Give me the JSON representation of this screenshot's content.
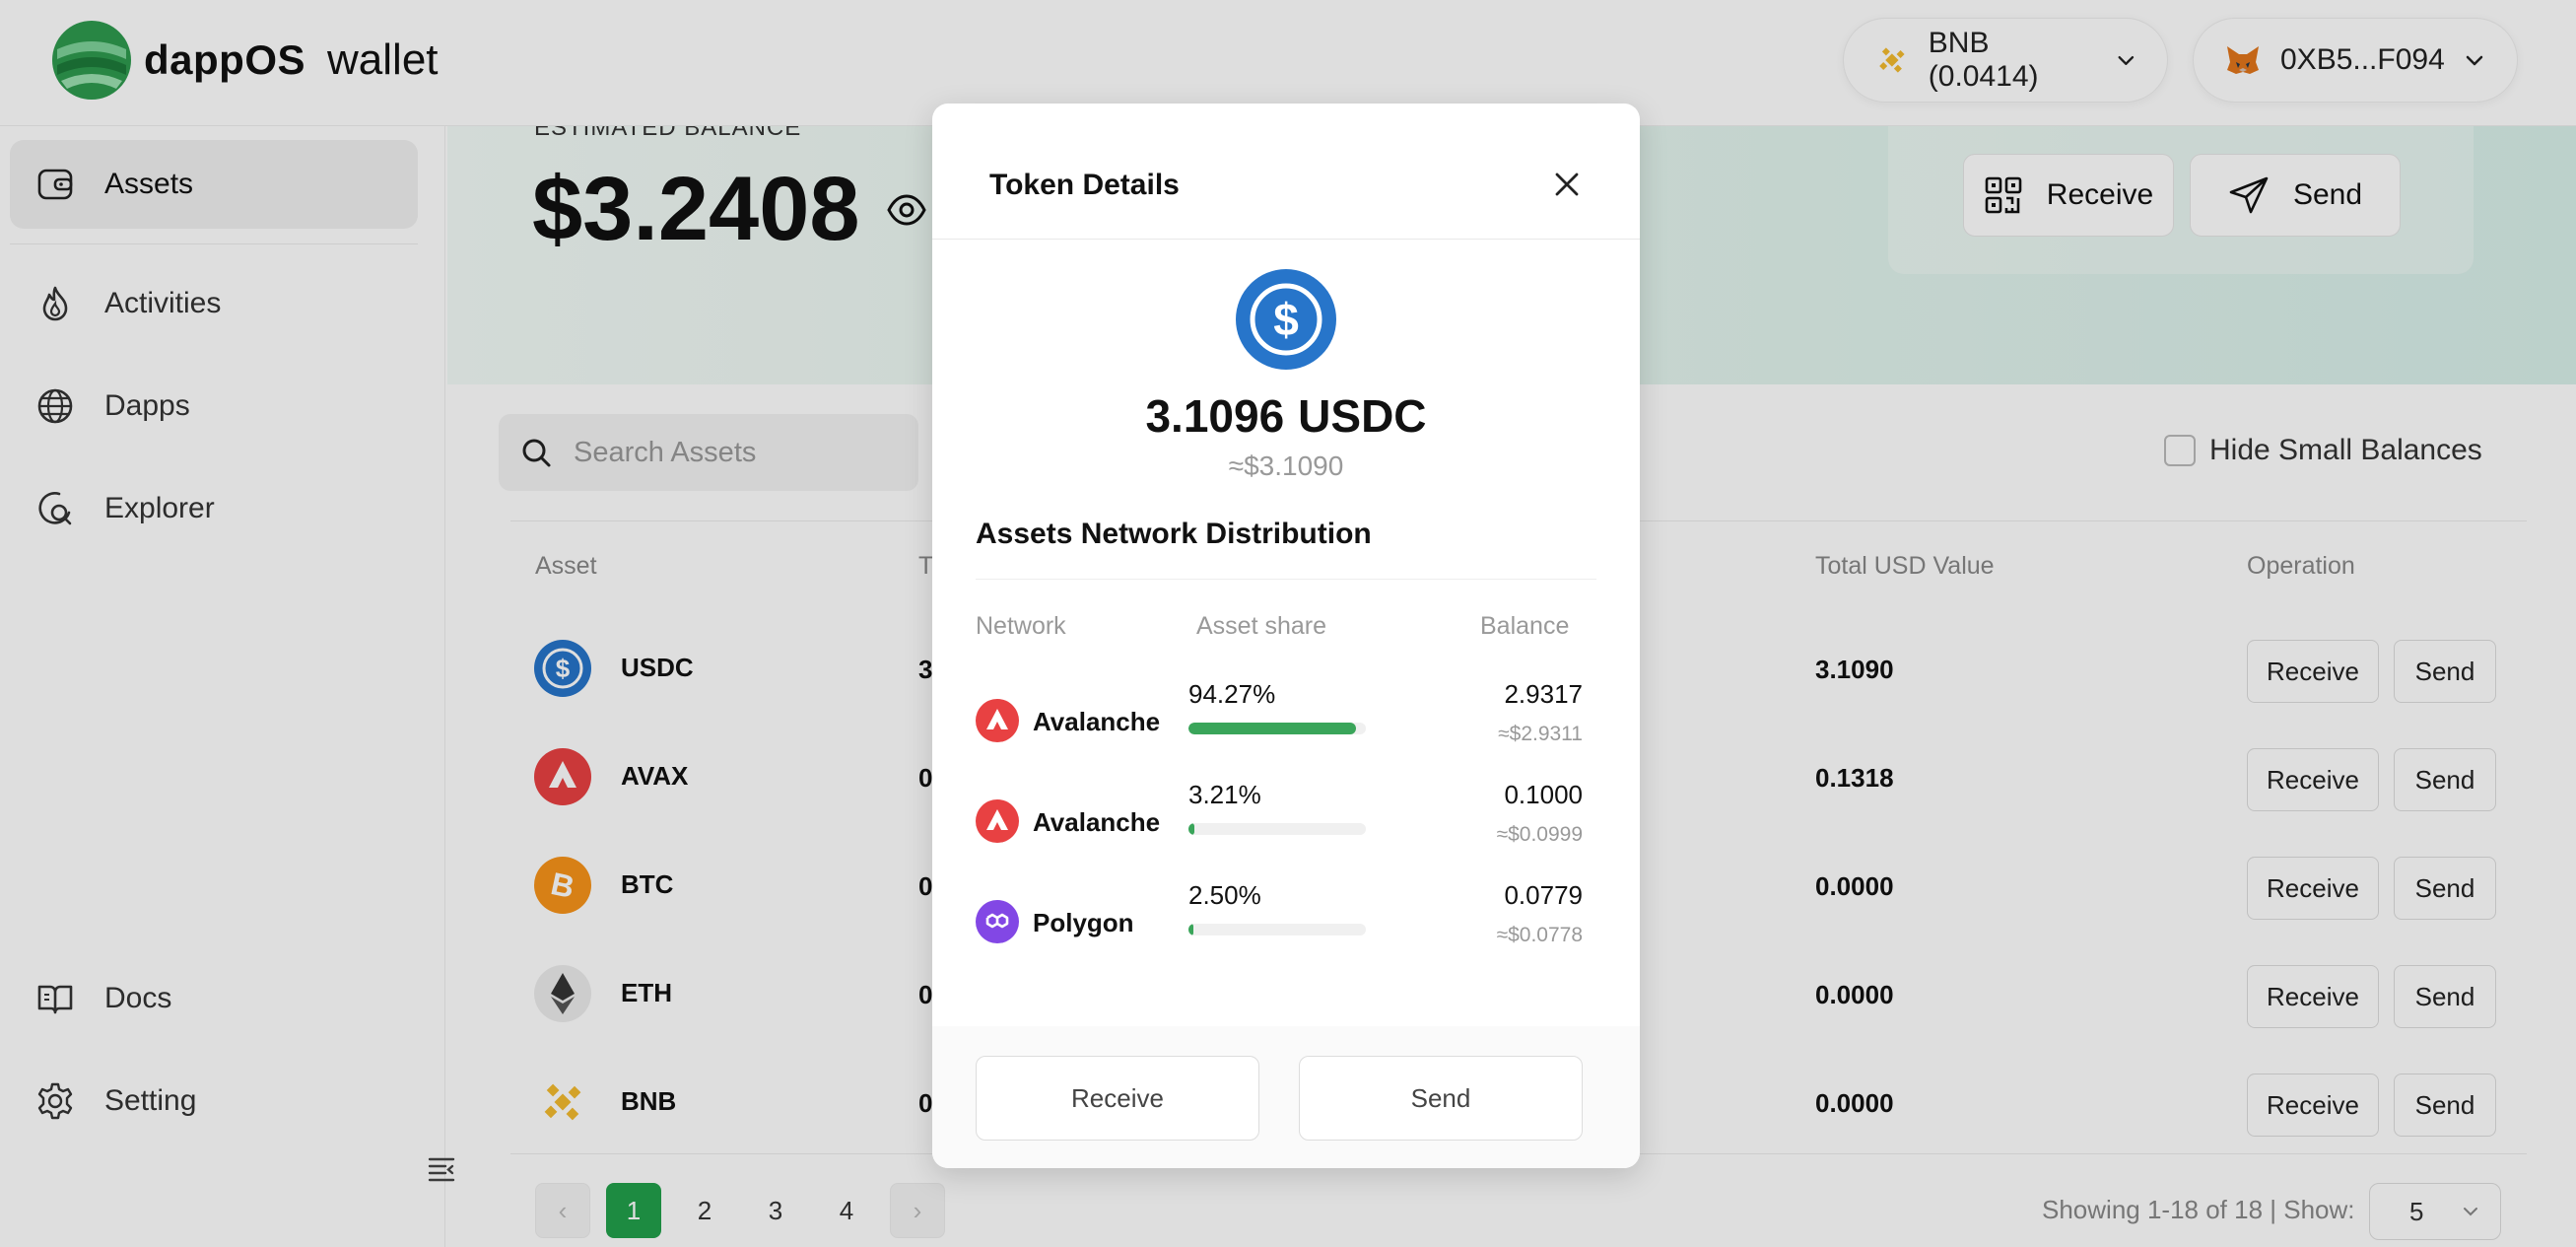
{
  "app": {
    "brand": "dappOS",
    "product": "wallet"
  },
  "header": {
    "network": {
      "label": "BNB (0.0414)",
      "icon": "bnb-icon"
    },
    "wallet": {
      "address": "0XB5...F094",
      "icon": "metamask-fox-icon"
    }
  },
  "sidebar": {
    "items": [
      {
        "label": "Assets",
        "icon": "wallet-icon",
        "active": true
      },
      {
        "label": "Activities",
        "icon": "flame-icon"
      },
      {
        "label": "Dapps",
        "icon": "globe-icon"
      },
      {
        "label": "Explorer",
        "icon": "compass-icon"
      }
    ],
    "bottom": [
      {
        "label": "Docs",
        "icon": "book-icon"
      },
      {
        "label": "Setting",
        "icon": "gear-icon"
      }
    ],
    "social": [
      "twitter-icon",
      "telegram-icon",
      "discord-icon",
      "gitbook-icon",
      "medium-icon"
    ]
  },
  "hero": {
    "label": "ESTIMATED BALANCE",
    "balance": "$3.2408",
    "receive_label": "Receive",
    "send_label": "Send"
  },
  "assets": {
    "search_placeholder": "Search Assets",
    "hide_small_label": "Hide Small Balances",
    "columns": {
      "asset": "Asset",
      "total": "T",
      "usd": "Total USD Value",
      "operation": "Operation"
    },
    "rows": [
      {
        "name": "USDC",
        "total": "3",
        "usd": "3.1090",
        "receive": "Receive",
        "send": "Send"
      },
      {
        "name": "AVAX",
        "total": "0",
        "usd": "0.1318",
        "receive": "Receive",
        "send": "Send"
      },
      {
        "name": "BTC",
        "total": "0",
        "usd": "0.0000",
        "receive": "Receive",
        "send": "Send"
      },
      {
        "name": "ETH",
        "total": "0",
        "usd": "0.0000",
        "receive": "Receive",
        "send": "Send"
      },
      {
        "name": "BNB",
        "total": "0",
        "usd": "0.0000",
        "receive": "Receive",
        "send": "Send"
      }
    ],
    "pagination": {
      "pages": [
        "1",
        "2",
        "3",
        "4"
      ],
      "current": "1",
      "prev": "‹",
      "next": "›"
    },
    "showing": "Showing 1-18 of 18 | Show:",
    "page_size": "5"
  },
  "modal": {
    "title": "Token Details",
    "amount": "3.1096",
    "symbol": "USDC",
    "usd_value": "≈$3.1090",
    "distribution_title": "Assets Network Distribution",
    "columns": {
      "network": "Network",
      "share": "Asset share",
      "balance": "Balance"
    },
    "networks": [
      {
        "name": "Avalanche",
        "share_label": "94.27%",
        "share": 0.9427,
        "balance": "2.9317",
        "balance_usd": "≈$2.9311",
        "icon": "avalanche-icon"
      },
      {
        "name": "Avalanche",
        "share_label": "3.21%",
        "share": 0.0321,
        "balance": "0.1000",
        "balance_usd": "≈$0.0999",
        "icon": "avalanche-icon"
      },
      {
        "name": "Polygon",
        "share_label": "2.50%",
        "share": 0.025,
        "balance": "0.0779",
        "balance_usd": "≈$0.0778",
        "icon": "polygon-icon"
      }
    ],
    "receive_label": "Receive",
    "send_label": "Send"
  },
  "colors": {
    "accent": "#22a04b",
    "usdc": "#2775ca",
    "avax": "#e84142",
    "btc": "#f7931a",
    "bnb": "#f3ba2f",
    "polygon": "#8247e5"
  }
}
